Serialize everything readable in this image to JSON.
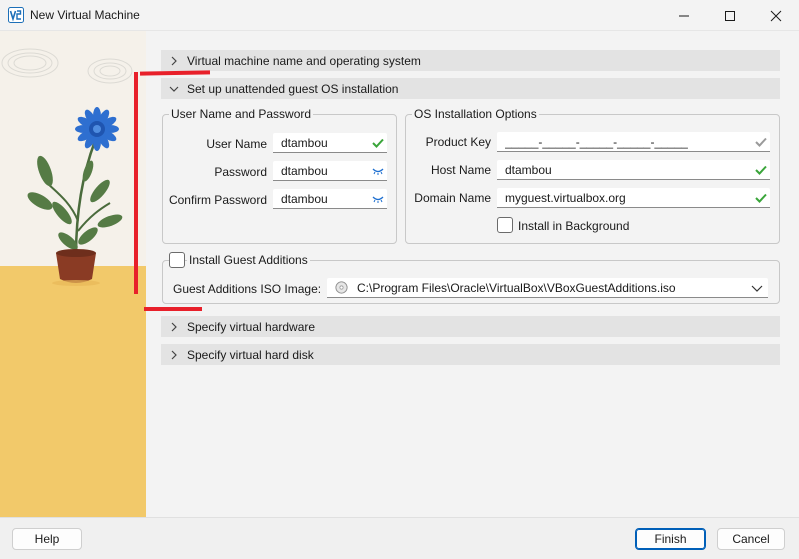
{
  "window": {
    "title": "New Virtual Machine",
    "icon": "virtualbox-app-icon",
    "controls": {
      "minimize": "minimize-icon",
      "maximize": "maximize-icon",
      "close": "close-icon"
    }
  },
  "sections": {
    "name_os": "Virtual machine name and operating system",
    "unattended": "Set up unattended guest OS installation",
    "hardware": "Specify virtual hardware",
    "hard_disk": "Specify virtual hard disk"
  },
  "user_group": {
    "title": "User Name and Password",
    "username_label": "User Name",
    "username_value": "dtambou",
    "password_label": "Password",
    "password_value": "dtambou",
    "confirm_label": "Confirm Password",
    "confirm_value": "dtambou"
  },
  "os_group": {
    "title": "OS Installation Options",
    "product_key_label": "Product Key",
    "product_key_value": "_____-_____-_____-_____-_____",
    "host_name_label": "Host Name",
    "host_name_value": "dtambou",
    "domain_label": "Domain Name",
    "domain_value": "myguest.virtualbox.org",
    "install_bg_label": "Install in Background",
    "install_bg_checked": false
  },
  "guest_additions": {
    "checkbox_label": "Install Guest Additions",
    "checked": false,
    "iso_label": "Guest Additions ISO Image:",
    "iso_value": "C:\\Program Files\\Oracle\\VirtualBox\\VBoxGuestAdditions.iso"
  },
  "footer": {
    "help": "Help",
    "finish": "Finish",
    "cancel": "Cancel"
  },
  "colors": {
    "valid_check": "#3aa53a",
    "key_icon": "#9a9a9a",
    "eye_icon": "#1e6fd0",
    "annotation": "#e8202a",
    "accent": "#005fb8"
  }
}
